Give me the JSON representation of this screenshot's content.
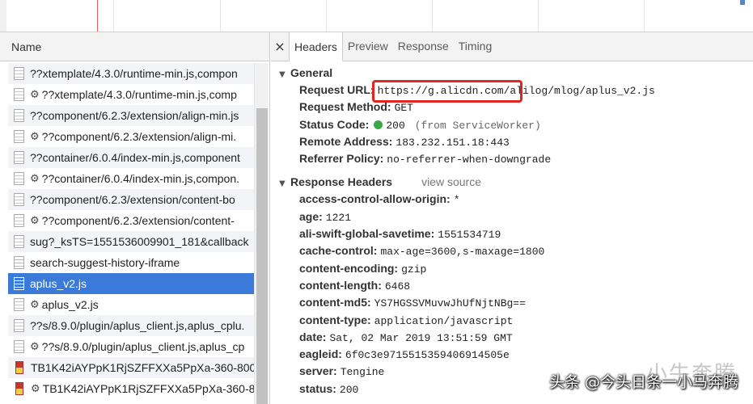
{
  "left_panel": {
    "header": "Name",
    "files": [
      {
        "name": "??xtemplate/4.3.0/runtime-min.js,compon",
        "gear": false,
        "icon": "script-file-icon",
        "alt": true,
        "selected": false
      },
      {
        "name": "??xtemplate/4.3.0/runtime-min.js,comp",
        "gear": true,
        "icon": "script-file-icon",
        "alt": false,
        "selected": false
      },
      {
        "name": "??component/6.2.3/extension/align-min.js",
        "gear": false,
        "icon": "script-file-icon",
        "alt": true,
        "selected": false
      },
      {
        "name": "??component/6.2.3/extension/align-mi.",
        "gear": true,
        "icon": "script-file-icon",
        "alt": false,
        "selected": false
      },
      {
        "name": "??container/6.0.4/index-min.js,component",
        "gear": false,
        "icon": "script-file-icon",
        "alt": true,
        "selected": false
      },
      {
        "name": "??container/6.0.4/index-min.js,compon.",
        "gear": true,
        "icon": "script-file-icon",
        "alt": false,
        "selected": false
      },
      {
        "name": "??component/6.2.3/extension/content-bo",
        "gear": false,
        "icon": "script-file-icon",
        "alt": true,
        "selected": false
      },
      {
        "name": "??component/6.2.3/extension/content-",
        "gear": true,
        "icon": "script-file-icon",
        "alt": false,
        "selected": false
      },
      {
        "name": "sug?_ksTS=1551536009901_181&callback",
        "gear": false,
        "icon": "script-file-icon",
        "alt": true,
        "selected": false
      },
      {
        "name": "search-suggest-history-iframe",
        "gear": false,
        "icon": "document-file-icon",
        "alt": false,
        "selected": false
      },
      {
        "name": "aplus_v2.js",
        "gear": false,
        "icon": "script-file-icon",
        "alt": false,
        "selected": true
      },
      {
        "name": "aplus_v2.js",
        "gear": true,
        "icon": "script-file-icon",
        "alt": false,
        "selected": false
      },
      {
        "name": "??s/8.9.0/plugin/aplus_client.js,aplus_cplu.",
        "gear": false,
        "icon": "script-file-icon",
        "alt": true,
        "selected": false
      },
      {
        "name": "??s/8.9.0/plugin/aplus_client.js,aplus_cp",
        "gear": true,
        "icon": "script-file-icon",
        "alt": false,
        "selected": false
      },
      {
        "name": "TB1K42iAYPpK1RjSZFFXXa5PpXa-360-800",
        "gear": false,
        "icon": "image-file-icon",
        "alt": true,
        "selected": false
      },
      {
        "name": "TB1K42iAYPpK1RjSZFFXXa5PpXa-360-8",
        "gear": true,
        "icon": "image-file-icon",
        "alt": false,
        "selected": false
      }
    ]
  },
  "tabs": {
    "close": "×",
    "items": [
      "Headers",
      "Preview",
      "Response",
      "Timing"
    ],
    "active": "Headers"
  },
  "general": {
    "title": "General",
    "request_url_label": "Request URL:",
    "request_url": "https://g.alicdn.com/alilog/mlog/aplus_v2.js",
    "request_method_label": "Request Method:",
    "request_method": "GET",
    "status_code_label": "Status Code:",
    "status_code": "200",
    "status_note": "(from ServiceWorker)",
    "status_color": "#3aa845",
    "remote_address_label": "Remote Address:",
    "remote_address": "183.232.151.18:443",
    "referrer_policy_label": "Referrer Policy:",
    "referrer_policy": "no-referrer-when-downgrade"
  },
  "response_headers": {
    "title": "Response Headers",
    "view_source": "view source",
    "items": [
      {
        "key": "access-control-allow-origin:",
        "value": "*"
      },
      {
        "key": "age:",
        "value": "1221"
      },
      {
        "key": "ali-swift-global-savetime:",
        "value": "1551534719"
      },
      {
        "key": "cache-control:",
        "value": "max-age=3600,s-maxage=1800"
      },
      {
        "key": "content-encoding:",
        "value": "gzip"
      },
      {
        "key": "content-length:",
        "value": "6468"
      },
      {
        "key": "content-md5:",
        "value": "YS7HGSSVMuvwJhUfNjtNBg=="
      },
      {
        "key": "content-type:",
        "value": "application/javascript"
      },
      {
        "key": "date:",
        "value": "Sat, 02 Mar 2019 13:51:59 GMT"
      },
      {
        "key": "eagleid:",
        "value": "6f0c3e9715515359406914505e"
      },
      {
        "key": "server:",
        "value": "Tengine"
      },
      {
        "key": "status:",
        "value": "200"
      }
    ]
  },
  "overlay": {
    "watermark": "小牛奔腾",
    "caption": "头条 @今头日条一小马奔腾"
  },
  "colors": {
    "selection": "#3b7ad9",
    "highlight_box": "#e0261f",
    "timeline_marker": "#e85c5c"
  }
}
